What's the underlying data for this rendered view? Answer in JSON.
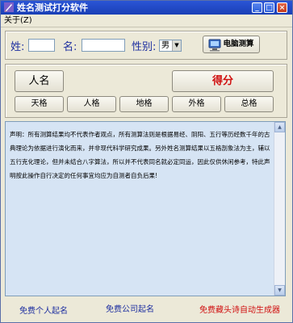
{
  "window": {
    "title": "姓名测试打分软件"
  },
  "titlebar_buttons": {
    "minimize": "_",
    "maximize": "□",
    "close": "×"
  },
  "menu": {
    "about": "关于(Z)"
  },
  "form": {
    "surname_label": "姓:",
    "name_label": "名:",
    "gender_label": "性别:",
    "gender_value": "男",
    "test_button": "电脑测算"
  },
  "results": {
    "name_header": "人名",
    "score_header": "得分",
    "score_color": "#d01010",
    "grids": [
      "天格",
      "人格",
      "地格",
      "外格",
      "总格"
    ]
  },
  "notice": {
    "text": "声明：所有测算结果均不代表作者观点，所有测算法则是根据易经、阴阳、五行等历经数千年的古典理论为依据进行演化而来，并非现代科学研究成果。另外姓名测算结果以五格剖象法为主，辅以五行克化理论，但并未结合八字算法，所以并不代表同名就必定同运，因此仅供休闲参考，特此声明按此操作自行决定的任何事宜均应为自测者自负后果!"
  },
  "footer": {
    "links": [
      {
        "label": "免费个人起名",
        "color": "#1d2ea0"
      },
      {
        "label": "免费公司起名",
        "color": "#1d2ea0"
      },
      {
        "label": "免费藏头诗自动生成器",
        "color": "#d01010"
      }
    ]
  }
}
